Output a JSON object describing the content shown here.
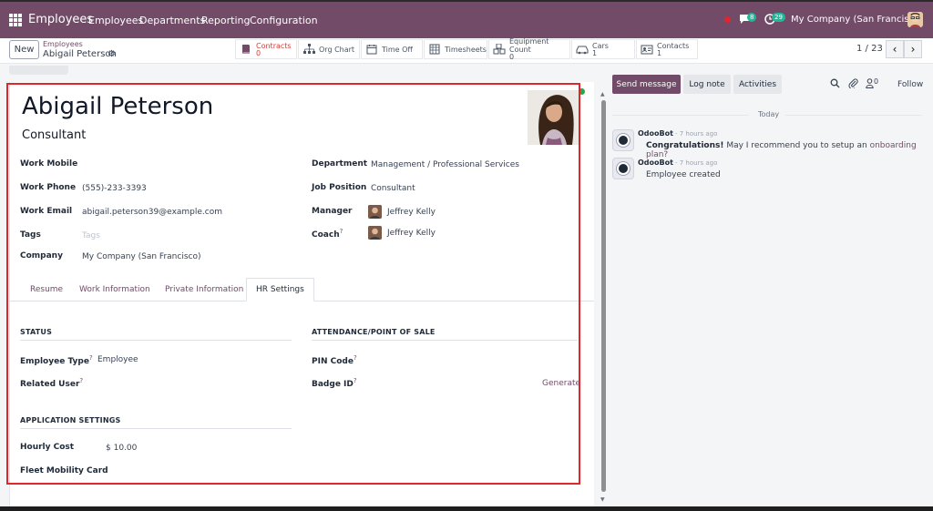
{
  "topbar": {
    "app_name": "Employees",
    "nav": [
      "Employees",
      "Departments",
      "Reporting",
      "Configuration"
    ],
    "messages_count": "8",
    "activities_count": "29",
    "company": "My Company (San Francisco)"
  },
  "control": {
    "new_label": "New",
    "breadcrumb_parent": "Employees",
    "breadcrumb_current": "Abigail Peterson",
    "smart_buttons": [
      {
        "label": "Contracts",
        "count": "0"
      },
      {
        "label": "Org Chart",
        "count": ""
      },
      {
        "label": "Time Off",
        "count": ""
      },
      {
        "label": "Timesheets",
        "count": ""
      },
      {
        "label": "Equipment Count",
        "count": "0"
      },
      {
        "label": "Cars",
        "count": "1"
      },
      {
        "label": "Contacts",
        "count": "1"
      }
    ],
    "pager": "1 / 23"
  },
  "employee": {
    "name": "Abigail Peterson",
    "job_title": "Consultant",
    "fields_left": [
      {
        "label": "Work Mobile",
        "value": ""
      },
      {
        "label": "Work Phone",
        "value": "(555)-233-3393"
      },
      {
        "label": "Work Email",
        "value": "abigail.peterson39@example.com"
      },
      {
        "label": "Tags",
        "value": "",
        "placeholder": "Tags"
      },
      {
        "label": "Company",
        "value": "My Company (San Francisco)"
      }
    ],
    "fields_right": [
      {
        "label": "Department",
        "value": "Management / Professional Services"
      },
      {
        "label": "Job Position",
        "value": "Consultant"
      },
      {
        "label": "Manager",
        "value": "Jeffrey Kelly"
      },
      {
        "label": "Coach",
        "value": "Jeffrey Kelly"
      }
    ]
  },
  "tabs": [
    "Resume",
    "Work Information",
    "Private Information",
    "HR Settings"
  ],
  "hr_settings": {
    "status_title": "STATUS",
    "employee_type_label": "Employee Type",
    "employee_type_value": "Employee",
    "related_user_label": "Related User",
    "attendance_title": "ATTENDANCE/POINT OF SALE",
    "pin_label": "PIN Code",
    "badge_label": "Badge ID",
    "generate_label": "Generate",
    "app_settings_title": "APPLICATION SETTINGS",
    "hourly_cost_label": "Hourly Cost",
    "hourly_cost_value": "$ 10.00",
    "fleet_label": "Fleet Mobility Card"
  },
  "chatter": {
    "send_message": "Send message",
    "log_note": "Log note",
    "activities": "Activities",
    "follow": "Follow",
    "followers_count": "0",
    "day": "Today",
    "messages": [
      {
        "author": "OdooBot",
        "time": "- 7 hours ago",
        "bold": "Congratulations!",
        "text": " May I recommend you to setup an ",
        "link": "onboarding plan?"
      },
      {
        "author": "OdooBot",
        "time": "- 7 hours ago",
        "bold": "",
        "text": "Employee created",
        "link": ""
      }
    ]
  }
}
